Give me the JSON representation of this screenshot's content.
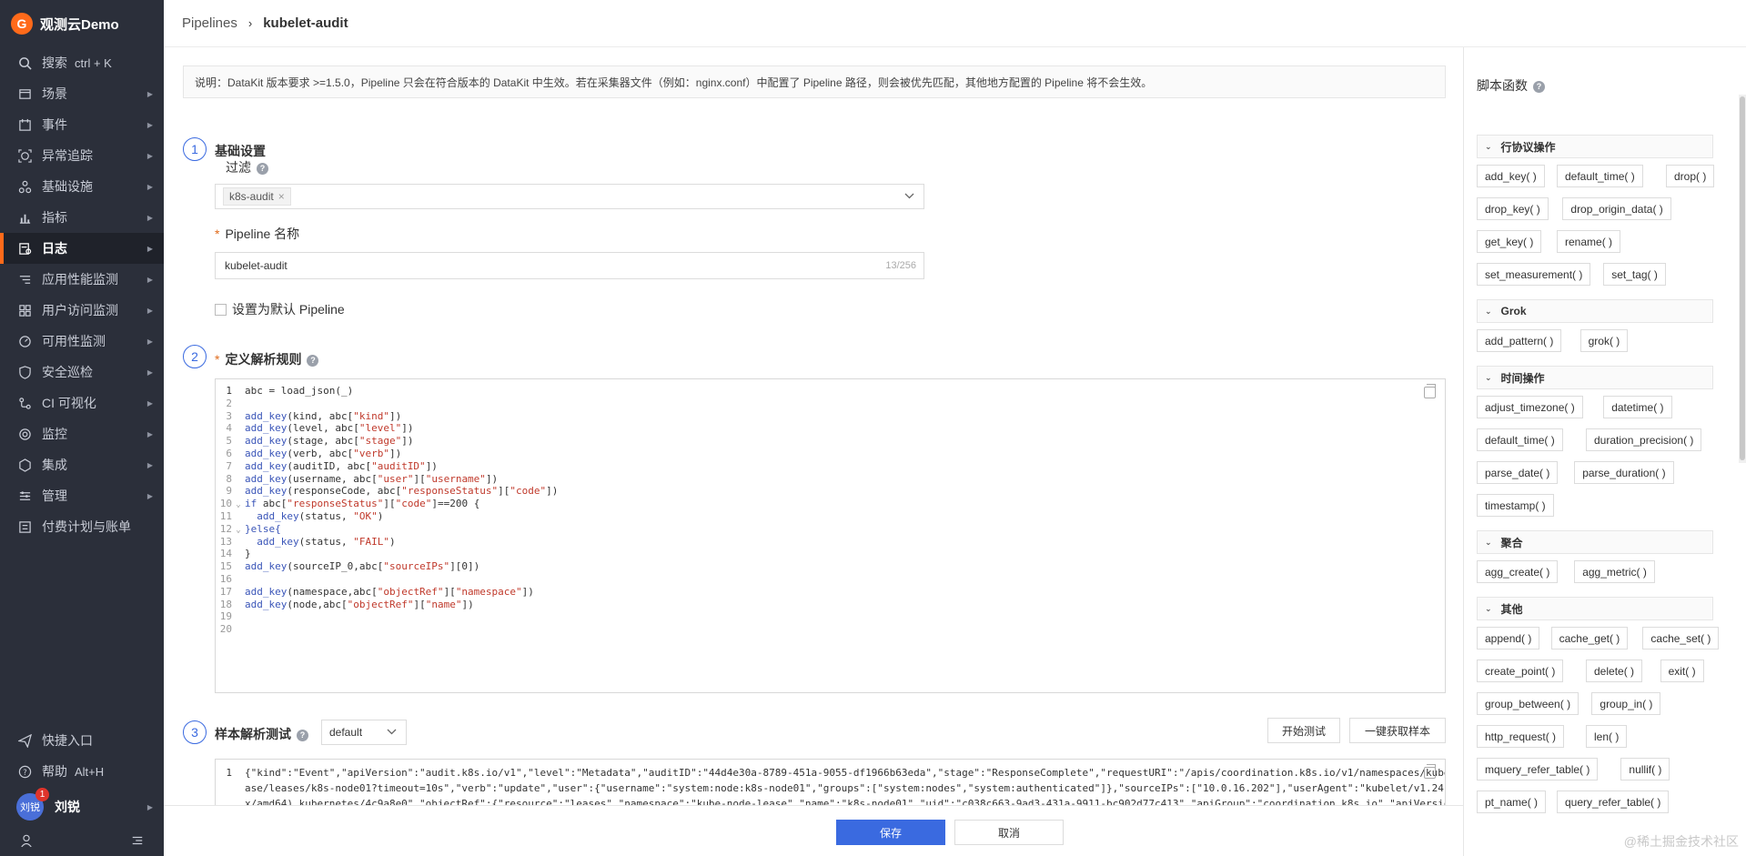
{
  "sidebar": {
    "logo": "观测云Demo",
    "logo_mark": "G",
    "search": {
      "label": "搜索",
      "shortcut": "ctrl + K"
    },
    "items": [
      {
        "label": "场景",
        "icon": "scene-icon"
      },
      {
        "label": "事件",
        "icon": "event-icon"
      },
      {
        "label": "异常追踪",
        "icon": "trace-icon"
      },
      {
        "label": "基础设施",
        "icon": "infra-icon"
      },
      {
        "label": "指标",
        "icon": "metrics-icon"
      },
      {
        "label": "日志",
        "icon": "logs-icon",
        "active": true
      },
      {
        "label": "应用性能监测",
        "icon": "apm-icon"
      },
      {
        "label": "用户访问监测",
        "icon": "rum-icon"
      },
      {
        "label": "可用性监测",
        "icon": "dial-icon"
      },
      {
        "label": "安全巡检",
        "icon": "security-icon"
      },
      {
        "label": "CI 可视化",
        "icon": "ci-icon"
      },
      {
        "label": "监控",
        "icon": "monitor-icon"
      },
      {
        "label": "集成",
        "icon": "integration-icon"
      },
      {
        "label": "管理",
        "icon": "manage-icon"
      },
      {
        "label": "付费计划与账单",
        "icon": "billing-icon"
      }
    ],
    "quick_entry": "快捷入口",
    "help": {
      "label": "帮助",
      "shortcut": "Alt+H"
    },
    "user": {
      "name": "刘锐",
      "avatar_text": "刘锐",
      "badge": "1"
    }
  },
  "header": {
    "breadcrumb_parent": "Pipelines",
    "breadcrumb_sep": "›",
    "breadcrumb_current": "kubelet-audit"
  },
  "notice": "说明：DataKit 版本要求 >=1.5.0，Pipeline 只会在符合版本的 DataKit 中生效。若在采集器文件（例如：nginx.conf）中配置了 Pipeline 路径，则会被优先匹配，其他地方配置的 Pipeline 将不会生效。",
  "step1": {
    "num": "1",
    "title": "基础设置",
    "filter_label": "过滤",
    "filter_tag": "k8s-audit",
    "filter_tag_x": "×",
    "name_label": "Pipeline 名称",
    "name_value": "kubelet-audit",
    "name_count": "13/256",
    "default_checkbox": "设置为默认 Pipeline"
  },
  "step2": {
    "num": "2",
    "title": "定义解析规则"
  },
  "code_lines": [
    "abc = load_json(_)",
    "",
    "add_key(kind, abc[\"kind\"])",
    "add_key(level, abc[\"level\"])",
    "add_key(stage, abc[\"stage\"])",
    "add_key(verb, abc[\"verb\"])",
    "add_key(auditID, abc[\"auditID\"])",
    "add_key(username, abc[\"user\"][\"username\"])",
    "add_key(responseCode, abc[\"responseStatus\"][\"code\"])",
    "if abc[\"responseStatus\"][\"code\"]==200 {",
    "  add_key(status, \"OK\")",
    "}else{",
    "  add_key(status, \"FAIL\")",
    "}",
    "add_key(sourceIP_0,abc[\"sourceIPs\"][0])",
    "",
    "add_key(namespace,abc[\"objectRef\"][\"namespace\"])",
    "add_key(node,abc[\"objectRef\"][\"name\"])",
    "",
    ""
  ],
  "step3": {
    "num": "3",
    "title": "样本解析测试",
    "select_value": "default",
    "start_test": "开始测试",
    "fetch_sample": "一键获取样本",
    "sample_lines": [
      "{\"kind\":\"Event\",\"apiVersion\":\"audit.k8s.io/v1\",\"level\":\"Metadata\",\"auditID\":\"44d4e30a-8789-451a-9055-df1966b63eda\",\"stage\":\"ResponseComplete\",\"requestURI\":\"/apis/coordination.k8s.io/v1/namespaces/kube-node-le",
      "ase/leases/k8s-node01?timeout=10s\",\"verb\":\"update\",\"user\":{\"username\":\"system:node:k8s-node01\",\"groups\":[\"system:nodes\",\"system:authenticated\"]},\"sourceIPs\":[\"10.0.16.202\"],\"userAgent\":\"kubelet/v1.24.0 (linu",
      "x/amd64) kubernetes/4c9a8e0\",\"objectRef\":{\"resource\":\"leases\",\"namespace\":\"kube-node-lease\",\"name\":\"k8s-node01\",\"uid\":\"c038c663-9ad3-431a-9911-bc902d77c413\",\"apiGroup\":\"coordination.k8s.io\",\"apiVersion\":\"v"
    ]
  },
  "footer": {
    "save": "保存",
    "cancel": "取消"
  },
  "functions_panel": {
    "title": "脚本函数",
    "groups": [
      {
        "title": "行协议操作",
        "items": [
          "add_key( )",
          "default_time( )",
          "drop( )",
          "drop_key( )",
          "drop_origin_data( )",
          "get_key( )",
          "rename( )",
          "set_measurement( )",
          "set_tag( )"
        ]
      },
      {
        "title": "Grok",
        "items": [
          "add_pattern( )",
          "grok( )"
        ]
      },
      {
        "title": "时间操作",
        "items": [
          "adjust_timezone( )",
          "datetime( )",
          "default_time( )",
          "duration_precision( )",
          "parse_date( )",
          "parse_duration( )",
          "timestamp( )"
        ]
      },
      {
        "title": "聚合",
        "items": [
          "agg_create( )",
          "agg_metric( )"
        ]
      },
      {
        "title": "其他",
        "items": [
          "append( )",
          "cache_get( )",
          "cache_set( )",
          "create_point( )",
          "delete( )",
          "exit( )",
          "group_between( )",
          "group_in( )",
          "http_request( )",
          "len( )",
          "mquery_refer_table( )",
          "nullif( )",
          "pt_name( )",
          "query_refer_table( )"
        ]
      }
    ]
  },
  "watermark": "@稀土掘金技术社区",
  "colors": {
    "accent": "#3a6ae0",
    "brand": "#ff6a1a",
    "sidebar_bg": "#2b2f3a"
  }
}
